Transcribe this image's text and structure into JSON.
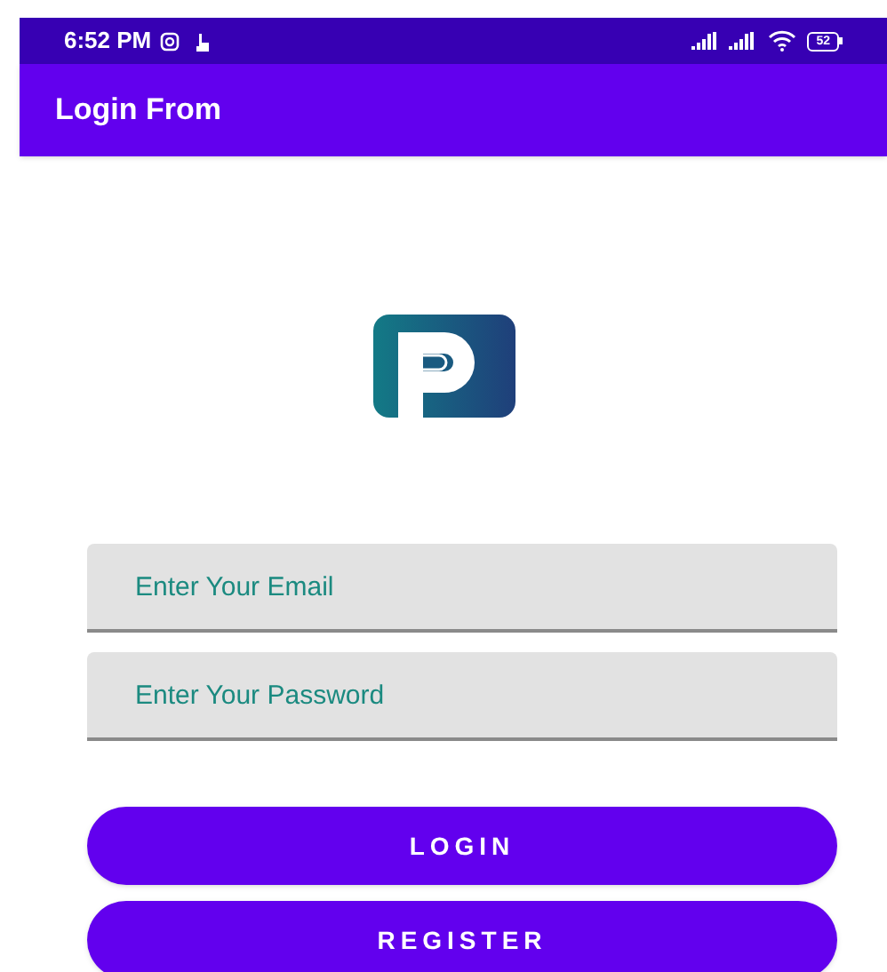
{
  "status_bar": {
    "time": "6:52 PM",
    "battery": "52"
  },
  "app_bar": {
    "title": "Login From"
  },
  "fields": [
    {
      "placeholder": "Enter Your Email"
    },
    {
      "placeholder": "Enter Your Password"
    }
  ],
  "buttons": [
    "LOGIN",
    "REGISTER"
  ]
}
